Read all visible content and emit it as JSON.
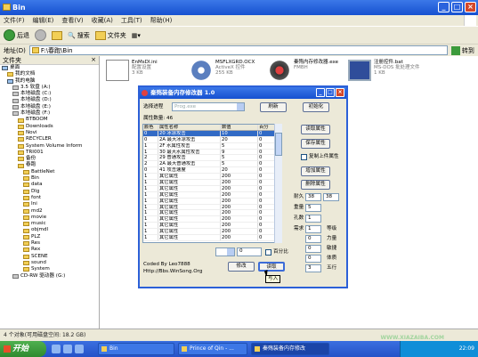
{
  "window": {
    "title": "Bin"
  },
  "menu": [
    "文件(F)",
    "编辑(E)",
    "查看(V)",
    "收藏(A)",
    "工具(T)",
    "帮助(H)"
  ],
  "toolbar": {
    "back": "后退",
    "search": "搜索",
    "folders": "文件夹"
  },
  "address": {
    "label": "地址(D)",
    "value": "F:\\春跑\\Bin",
    "go": "转到"
  },
  "sidebar": {
    "header": "文件夹",
    "close": "×",
    "items": [
      {
        "label": "桌面",
        "icon": "desktop-icon",
        "indent": 0
      },
      {
        "label": "我的文档",
        "icon": "folder-icon",
        "indent": 1
      },
      {
        "label": "我的电脑",
        "icon": "computer-icon",
        "indent": 1
      },
      {
        "label": "3.5 软盘 (A:)",
        "icon": "floppy-icon",
        "indent": 2
      },
      {
        "label": "本地磁盘 (C:)",
        "icon": "drive-icon",
        "indent": 2
      },
      {
        "label": "本地磁盘 (D:)",
        "icon": "drive-icon",
        "indent": 2
      },
      {
        "label": "本地磁盘 (E:)",
        "icon": "drive-icon",
        "indent": 2
      },
      {
        "label": "本地磁盘 (F:)",
        "icon": "drive-icon",
        "indent": 2
      },
      {
        "label": "BTBOOM",
        "icon": "folder-icon",
        "indent": 3
      },
      {
        "label": "Downloads",
        "icon": "folder-icon",
        "indent": 3
      },
      {
        "label": "Novi",
        "icon": "folder-icon",
        "indent": 3
      },
      {
        "label": "RECYCLER",
        "icon": "folder-icon",
        "indent": 3
      },
      {
        "label": "System Volume Inform",
        "icon": "folder-icon",
        "indent": 3
      },
      {
        "label": "TRI001",
        "icon": "folder-icon",
        "indent": 3
      },
      {
        "label": "备份",
        "icon": "folder-icon",
        "indent": 3
      },
      {
        "label": "春跑",
        "icon": "folder-icon",
        "indent": 3
      },
      {
        "label": "BattleNet",
        "icon": "folder-icon",
        "indent": 4
      },
      {
        "label": "Bin",
        "icon": "folder-icon",
        "indent": 4
      },
      {
        "label": "data",
        "icon": "folder-icon",
        "indent": 4
      },
      {
        "label": "Dlg",
        "icon": "folder-icon",
        "indent": 4
      },
      {
        "label": "font",
        "icon": "folder-icon",
        "indent": 4
      },
      {
        "label": "Ini",
        "icon": "folder-icon",
        "indent": 4
      },
      {
        "label": "md2",
        "icon": "folder-icon",
        "indent": 4
      },
      {
        "label": "movie",
        "icon": "folder-icon",
        "indent": 4
      },
      {
        "label": "music",
        "icon": "folder-icon",
        "indent": 4
      },
      {
        "label": "objmdl",
        "icon": "folder-icon",
        "indent": 4
      },
      {
        "label": "PLZ",
        "icon": "folder-icon",
        "indent": 4
      },
      {
        "label": "Res",
        "icon": "folder-icon",
        "indent": 4
      },
      {
        "label": "Rex",
        "icon": "folder-icon",
        "indent": 4
      },
      {
        "label": "SCENE",
        "icon": "folder-icon",
        "indent": 4
      },
      {
        "label": "sound",
        "icon": "folder-icon",
        "indent": 4
      },
      {
        "label": "System",
        "icon": "folder-icon",
        "indent": 4
      },
      {
        "label": "CD-RW 驱动器 (G:)",
        "icon": "cdrom-icon",
        "indent": 2
      }
    ]
  },
  "files": [
    {
      "name": "EnMsDl.ini",
      "sub1": "配置设置",
      "sub2": "3 KB",
      "icon": "ini-file-icon"
    },
    {
      "name": "MSFLXGRD.OCX",
      "sub1": "ActiveX 控件",
      "sub2": "255 KB",
      "icon": "activex-icon"
    },
    {
      "name": "秦殇内存修改器.exe",
      "sub1": "FMBH",
      "sub2": "",
      "icon": "trainer-exe-icon"
    },
    {
      "name": "注册控件.bat",
      "sub1": "MS-DOS 批处理文件",
      "sub2": "1 KB",
      "icon": "bat-file-icon"
    }
  ],
  "status": {
    "text": "4 个对象(可用磁盘空间: 18.2 GB)"
  },
  "taskbar": {
    "start": "开始",
    "tasks": [
      "Bin",
      "Prince of Qin - ...",
      "秦殇装备内存修改"
    ],
    "clock": "22:09"
  },
  "watermark": "WWW.XIAZAIBA.COM",
  "modal": {
    "title": "秦殇装备内存修改器 1.0",
    "process_label": "选择进程",
    "process_value": "Prog.exe",
    "refresh": "刷新",
    "init": "初始化",
    "count_label": "属性数量: 46",
    "columns": [
      "颜色",
      "属性名称",
      "数值",
      "百分"
    ],
    "rows": [
      [
        "0",
        "20 冰凉攻击",
        "10",
        "0"
      ],
      [
        "0",
        "2A 最大冰凉攻击",
        "20",
        "0"
      ],
      [
        "1",
        "2F 水属性攻击",
        "5",
        "0"
      ],
      [
        "1",
        "30 最大水属性攻击",
        "9",
        "0"
      ],
      [
        "2",
        "29 普通攻击",
        "5",
        "0"
      ],
      [
        "2",
        "2A 最大普通攻击",
        "5",
        "0"
      ],
      [
        "0",
        "41 攻击速度",
        "20",
        "0"
      ],
      [
        "1",
        "其它属性",
        "200",
        "0"
      ],
      [
        "1",
        "其它属性",
        "200",
        "0"
      ],
      [
        "1",
        "其它属性",
        "200",
        "0"
      ],
      [
        "1",
        "其它属性",
        "200",
        "0"
      ],
      [
        "1",
        "其它属性",
        "200",
        "0"
      ],
      [
        "1",
        "其它属性",
        "200",
        "0"
      ],
      [
        "1",
        "其它属性",
        "200",
        "0"
      ],
      [
        "1",
        "其它属性",
        "200",
        "0"
      ],
      [
        "1",
        "其它属性",
        "200",
        "0"
      ],
      [
        "1",
        "其它属性",
        "200",
        "0"
      ],
      [
        "1",
        "其它属性",
        "200",
        "0"
      ]
    ],
    "btn_read": "读取属性",
    "btn_save": "保存属性",
    "chk_fixed": "复制上件属性",
    "btn_add": "增加属性",
    "btn_del": "删除属性",
    "durability_label": "耐久",
    "durability_a": "38",
    "durability_b": "38",
    "weight_label": "重量",
    "weight_value": "5",
    "holes_label": "孔数",
    "holes_value": "1",
    "req_label": "需求",
    "req_value": "1",
    "level_label": "等级",
    "str_label": "力量",
    "agi_label": "敏捷",
    "con_label": "体质",
    "five_label": "五行",
    "stat_values": [
      "0",
      "0",
      "0",
      "0",
      "3"
    ],
    "edit_value": "0",
    "pct_label": "百分比",
    "coded_by": "Coded By Leo7888",
    "site": "Http://Bbs.WinSong.Org",
    "btn_modify": "修改",
    "btn_read2": "读取",
    "cursor_tip": "写入"
  }
}
